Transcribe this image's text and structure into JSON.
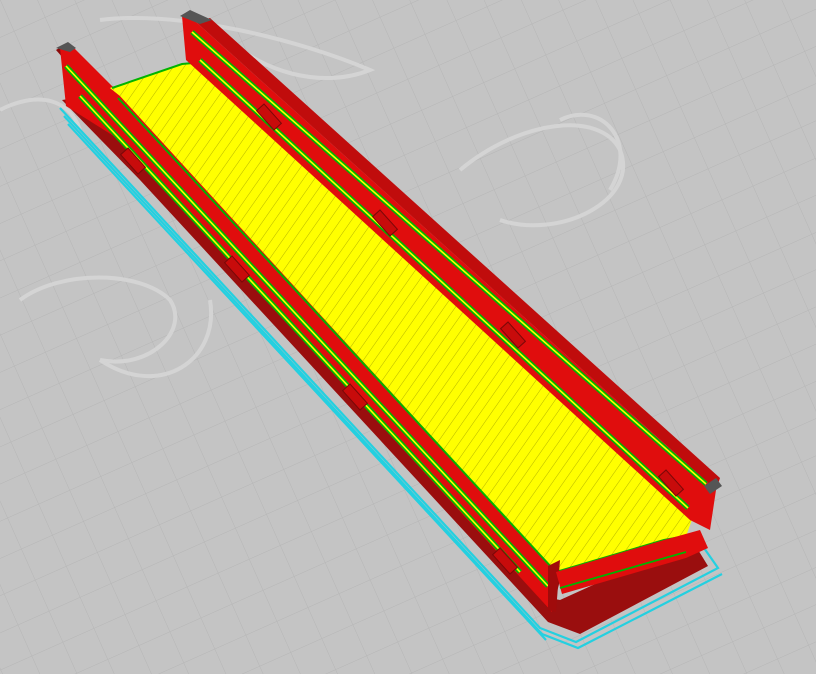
{
  "viewport": {
    "type": "3d-slicer-layer-preview",
    "background_color": "#c4c4c4",
    "grid_color": "#b8b8b8",
    "watermark_color": "#d2d2d2"
  },
  "model": {
    "shape": "open-channel-tray",
    "wall_color": "#e00d0d",
    "wall_shadow_color": "#8c0a0a",
    "wall_top_color": "#555555",
    "outer_perimeter_color": "#00b400",
    "top_surface_color": "#ffff00",
    "skirt_color": "#24d0e0"
  },
  "legend": [
    {
      "feature": "outer-wall",
      "color": "#e00d0d"
    },
    {
      "feature": "outer-perimeter",
      "color": "#00b400"
    },
    {
      "feature": "top-solid-infill",
      "color": "#ffff00"
    },
    {
      "feature": "skirt-brim",
      "color": "#24d0e0"
    }
  ]
}
